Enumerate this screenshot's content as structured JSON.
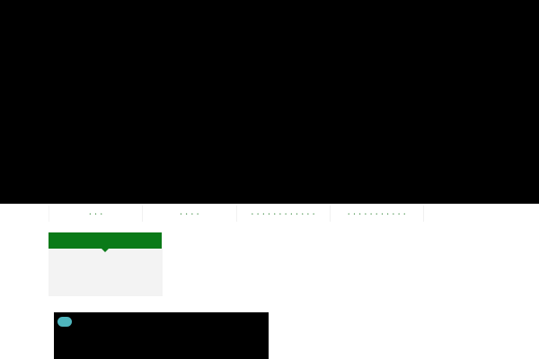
{
  "nav": {
    "items": [
      {
        "label": "・・・"
      },
      {
        "label": "・・・・"
      },
      {
        "label": "・・・・・・・・・・・・"
      },
      {
        "label": "・・・・・・・・・・・"
      }
    ]
  },
  "colors": {
    "hero": "#000000",
    "nav_text": "#3a8a3f",
    "panel_header": "#0a7a18",
    "panel_body": "#f3f3f3",
    "media": "#000000",
    "media_pill": "#4fb5bd"
  },
  "icons": {
    "media_pill": "pill-badge-icon"
  }
}
